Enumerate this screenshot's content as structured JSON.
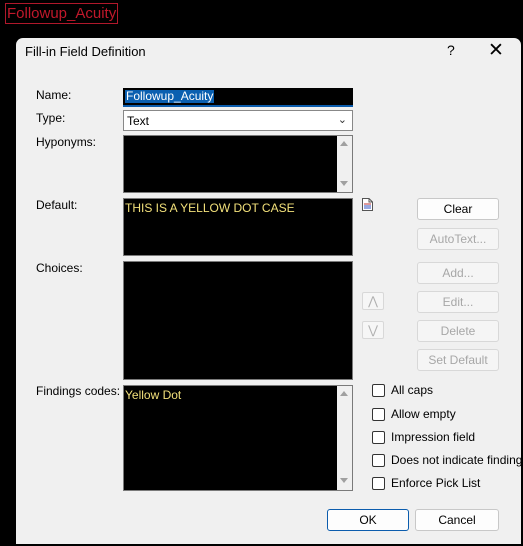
{
  "window_tab": "Followup_Acuity",
  "dialog": {
    "title": "Fill-in Field Definition",
    "help_glyph": "?",
    "close_glyph": "✕"
  },
  "form": {
    "name_label": "Name:",
    "name_value": "Followup_Acuity",
    "type_label": "Type:",
    "type_value": "Text",
    "hyponyms_label": "Hyponyms:",
    "default_label": "Default:",
    "default_value": "THIS IS A YELLOW DOT CASE",
    "choices_label": "Choices:",
    "findings_label": "Findings codes:",
    "findings_value": "Yellow Dot"
  },
  "buttons": {
    "clear": "Clear",
    "autotext": "AutoText...",
    "add": "Add...",
    "edit": "Edit...",
    "delete": "Delete",
    "set_default": "Set Default",
    "ok": "OK",
    "cancel": "Cancel",
    "move_up": "⋀",
    "move_down": "⋁"
  },
  "checkboxes": [
    {
      "label": "All caps",
      "checked": false
    },
    {
      "label": "Allow empty",
      "checked": false
    },
    {
      "label": "Impression field",
      "checked": false
    },
    {
      "label": "Does not indicate findings",
      "checked": false
    },
    {
      "label": "Enforce Pick List",
      "checked": false
    }
  ],
  "colors": {
    "accent": "#0b5cad",
    "field_text": "#f2e07a",
    "tab_text": "#c0182b"
  }
}
